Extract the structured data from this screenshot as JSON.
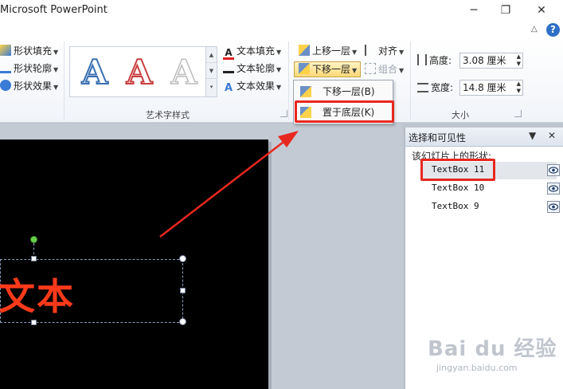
{
  "app": {
    "title": "Microsoft PowerPoint"
  },
  "window_controls": {
    "minimize": "─",
    "restore": "❐",
    "close": "✕"
  },
  "ribbon": {
    "shape_styles": {
      "fill": "形状填充",
      "outline": "形状轮廓",
      "effects": "形状效果"
    },
    "wordart": {
      "gallery_letter": "A",
      "text_fill": "文本填充",
      "text_outline": "文本轮廓",
      "text_effects": "文本效果",
      "group_label": "艺术字样式"
    },
    "arrange": {
      "bring_forward": "上移一层",
      "send_backward": "下移一层",
      "align": "对齐",
      "group": "组合"
    },
    "size": {
      "height_label": "高度:",
      "height_value": "3.08 厘米",
      "width_label": "宽度:",
      "width_value": "14.8 厘米",
      "group_label": "大小"
    }
  },
  "dropdown_menu": {
    "items": [
      {
        "label": "下移一层(B)"
      },
      {
        "label": "置于底层(K)"
      }
    ]
  },
  "slide": {
    "text": "文本"
  },
  "selection_pane": {
    "title": "选择和可见性",
    "subtitle": "该幻灯片上的形状:",
    "shapes": [
      {
        "name": "TextBox 11",
        "selected": true
      },
      {
        "name": "TextBox 10",
        "selected": false
      },
      {
        "name": "TextBox 9",
        "selected": false
      }
    ]
  },
  "watermark": {
    "text": "Bai du 经验",
    "sub": "jingyan.baidu.com"
  },
  "colors": {
    "highlight": "#e8281f",
    "slide_text": "#ff3a1a",
    "arrow": "#e8281f"
  }
}
